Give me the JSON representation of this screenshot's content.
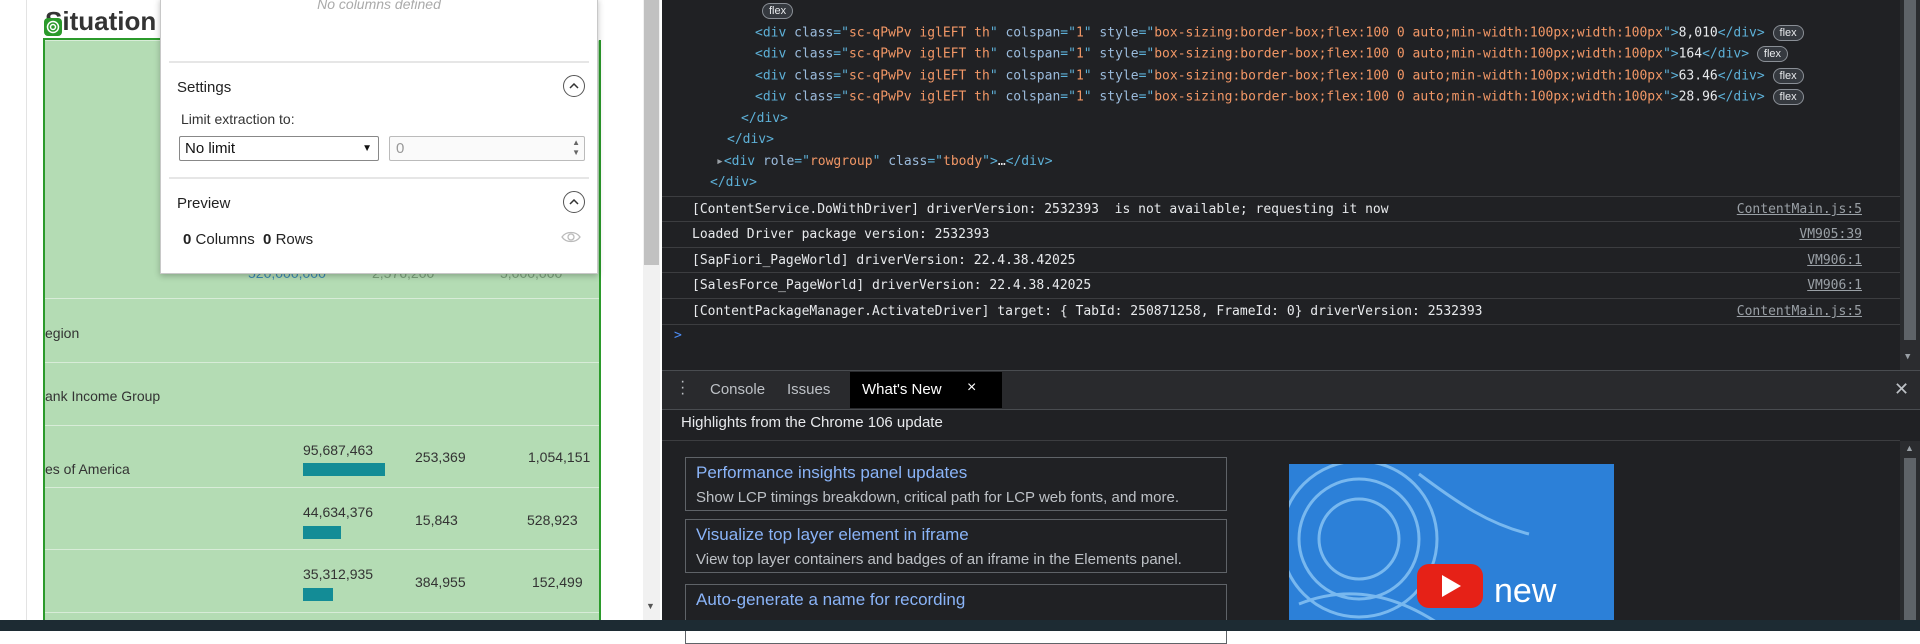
{
  "left_page": {
    "title": "Situation",
    "faint_values": [
      "520,000,000",
      "2,576,200",
      "5,000,000"
    ],
    "rows": [
      {
        "label": "egion"
      },
      {
        "label": "ank Income Group"
      }
    ],
    "data_rows": [
      {
        "label": "es of America",
        "value1": "95,687,463",
        "bar_fraction": 0.82,
        "value2": "253,369",
        "value3": "1,054,151"
      },
      {
        "label": "",
        "value1": "44,634,376",
        "bar_fraction": 0.38,
        "value2": "15,843",
        "value3": "528,923"
      },
      {
        "label": "",
        "value1": "35,312,935",
        "bar_fraction": 0.3,
        "value2": "384,955",
        "value3": "152,499"
      }
    ]
  },
  "popup": {
    "no_columns_text": "No columns defined",
    "settings_title": "Settings",
    "limit_label": "Limit extraction to:",
    "limit_select_value": "No limit",
    "limit_number_value": "0",
    "preview_title": "Preview",
    "columns_count": "0",
    "columns_label": "Columns",
    "rows_count": "0",
    "rows_label": "Rows"
  },
  "devtools": {
    "elements": {
      "flex_badge": "flex",
      "cells": [
        {
          "tag": "div",
          "class": "sc-qPwPv iglEFT th",
          "colspan": "1",
          "style": "box-sizing:border-box;flex:100 0 auto;min-width:100px;width:100px",
          "text": "8,010"
        },
        {
          "tag": "div",
          "class": "sc-qPwPv iglEFT th",
          "colspan": "1",
          "style": "box-sizing:border-box;flex:100 0 auto;min-width:100px;width:100px",
          "text": "164"
        },
        {
          "tag": "div",
          "class": "sc-qPwPv iglEFT th",
          "colspan": "1",
          "style": "box-sizing:border-box;flex:100 0 auto;min-width:100px;width:100px",
          "text": "63.46"
        },
        {
          "tag": "div",
          "class": "sc-qPwPv iglEFT th",
          "colspan": "1",
          "style": "box-sizing:border-box;flex:100 0 auto;min-width:100px;width:100px",
          "text": "28.96"
        }
      ],
      "closing_div": "</div>",
      "tbody_role": "rowgroup",
      "tbody_class": "tbody",
      "tbody_ellipsis": "…"
    },
    "console": [
      {
        "message": "[ContentService.DoWithDriver] driverVersion: 2532393  is not available; requesting it now",
        "source": "ContentMain.js:5"
      },
      {
        "message": "Loaded Driver package version: 2532393",
        "source": "VM905:39"
      },
      {
        "message": "[SapFiori_PageWorld] driverVersion: 22.4.38.42025",
        "source": "VM906:1"
      },
      {
        "message": "[SalesForce_PageWorld] driverVersion: 22.4.38.42025",
        "source": "VM906:1"
      },
      {
        "message": "[ContentPackageManager.ActivateDriver] target: { TabId: 250871258, FrameId: 0} driverVersion: 2532393",
        "source": "ContentMain.js:5"
      }
    ],
    "prompt_symbol": ">",
    "drawer_tabs": [
      "Console",
      "Issues",
      "What's New"
    ],
    "active_tab_close": "×",
    "whats_new": {
      "heading": "Highlights from the Chrome 106 update",
      "cards": [
        {
          "title": "Performance insights panel updates",
          "desc": "Show LCP timings breakdown, critical path for LCP web fonts, and more."
        },
        {
          "title": "Visualize top layer element in iframe",
          "desc": "View top layer containers and badges of an iframe in the Elements panel."
        },
        {
          "title": "Auto-generate a name for recording",
          "desc": ""
        }
      ],
      "video_label": "new"
    },
    "colors": {
      "background": "#202124",
      "tag": "#5db0d7",
      "attr_value": "#f29766",
      "link": "#8ab4f8"
    }
  }
}
